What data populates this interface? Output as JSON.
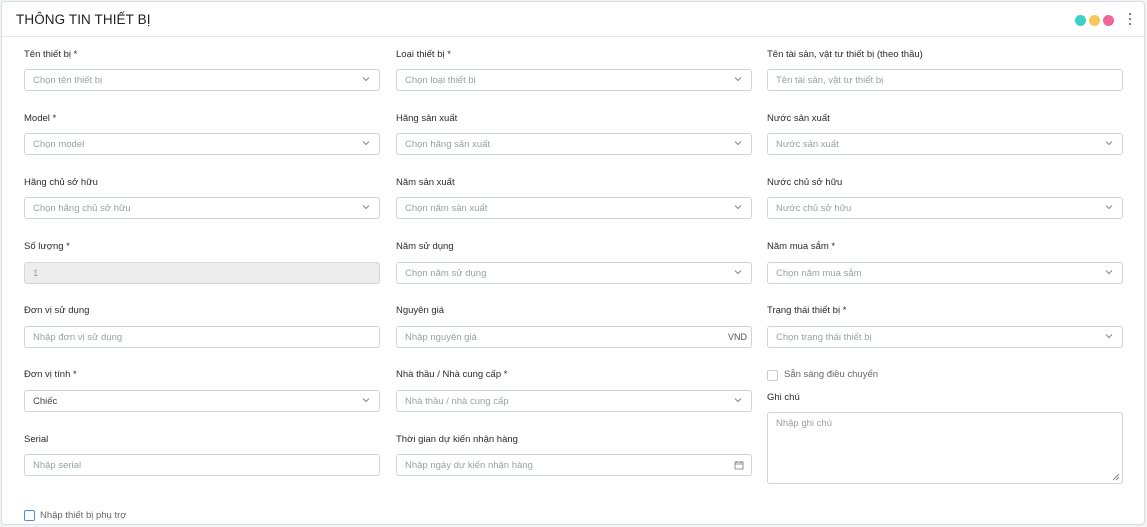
{
  "header": {
    "title": "THÔNG TIN THIẾT BỊ",
    "dot_colors": [
      "#3dd0c4",
      "#f7c859",
      "#f2659a"
    ]
  },
  "form": {
    "ten_thiet_bi": {
      "label": "Tên thiết bị *",
      "placeholder": "Chọn tên thiết bị"
    },
    "loai_thiet_bi": {
      "label": "Loại thiết bị *",
      "placeholder": "Chọn loại thiết bị"
    },
    "ten_tai_san": {
      "label": "Tên tài sản, vật tư thiết bị (theo thầu)",
      "placeholder": "Tên tài sản, vật tư thiết bị"
    },
    "model": {
      "label": "Model *",
      "placeholder": "Chọn model"
    },
    "hang_san_xuat": {
      "label": "Hãng sản xuất",
      "placeholder": "Chọn hãng sản xuất"
    },
    "nuoc_san_xuat": {
      "label": "Nước sản xuất",
      "placeholder": "Nước sản xuất"
    },
    "hang_chu_so_huu": {
      "label": "Hãng chủ sở hữu",
      "placeholder": "Chọn hãng chủ sở hữu"
    },
    "nam_san_xuat": {
      "label": "Năm sản xuất",
      "placeholder": "Chọn năm sản xuất"
    },
    "nuoc_chu_so_huu": {
      "label": "Nước chủ sở hữu",
      "placeholder": "Nước chủ sở hữu"
    },
    "so_luong": {
      "label": "Số lượng *",
      "value": "1"
    },
    "nam_su_dung": {
      "label": "Năm sử dụng",
      "placeholder": "Chọn năm sử dụng"
    },
    "nam_mua_sam": {
      "label": "Năm mua sắm *",
      "placeholder": "Chọn năm mua sắm"
    },
    "don_vi_su_dung": {
      "label": "Đơn vị sử dụng",
      "placeholder": "Nhập đơn vị sử dụng"
    },
    "nguyen_gia": {
      "label": "Nguyên giá",
      "placeholder": "Nhập nguyên giá",
      "suffix": "VND"
    },
    "trang_thai": {
      "label": "Trạng thái thiết bị *",
      "placeholder": "Chọn trạng thái thiết bị"
    },
    "don_vi_tinh": {
      "label": "Đơn vị tính *",
      "value": "Chiếc"
    },
    "nha_thau": {
      "label": "Nhà thầu / Nhà cung cấp *",
      "placeholder": "Nhà thầu / nhà cung cấp"
    },
    "san_sang": {
      "label": "Sẵn sàng điều chuyển",
      "checked": false
    },
    "ghi_chu": {
      "label": "Ghi chú",
      "placeholder": "Nhập ghi chú"
    },
    "serial": {
      "label": "Serial",
      "placeholder": "Nhập serial"
    },
    "thoi_gian": {
      "label": "Thời gian dự kiến nhận hàng",
      "placeholder": "Nhập ngày dự kiến nhận hàng"
    },
    "phu_tro": {
      "label": "Nhập thiết bị phụ trợ",
      "checked": false
    }
  }
}
